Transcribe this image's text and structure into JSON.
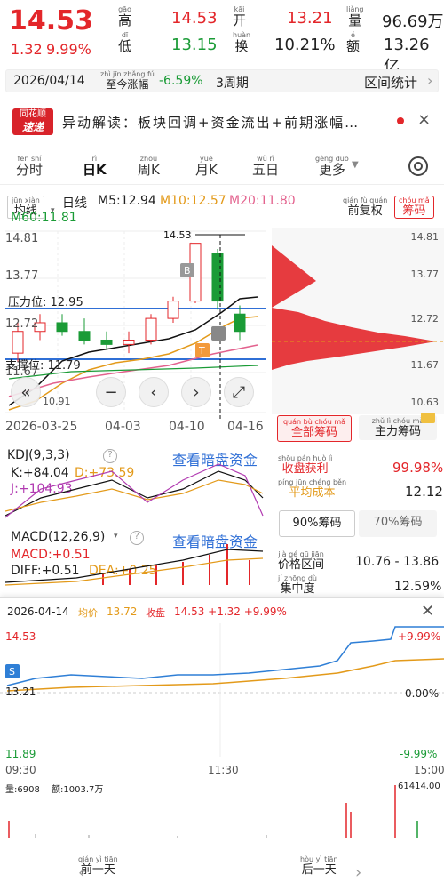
{
  "quote": {
    "price": "14.53",
    "change": "1.32",
    "change_pct": "9.99%",
    "high_label": "高",
    "high_py": "gāo",
    "high": "14.53",
    "open_label": "开",
    "open_py": "kāi",
    "open": "13.21",
    "vol_label": "量",
    "vol_py": "liàng",
    "vol": "96.69万",
    "low_label": "低",
    "low_py": "dī",
    "low": "13.15",
    "turn_label": "换",
    "turn_py": "huàn",
    "turn": "10.21%",
    "amt_label": "额",
    "amt_py": "é",
    "amt": "13.26亿"
  },
  "range": {
    "date": "2026/04/14",
    "text": "至今涨幅",
    "text_py": "zhì jīn zhǎng fú",
    "pct": "-6.59%",
    "period": "3周期",
    "stat": "区间统计"
  },
  "news": {
    "logo_top": "同花顺",
    "logo_bottom": "速递",
    "text": "异动解读：板块回调+资金流出+前期涨幅…",
    "close": "×"
  },
  "tabs": [
    {
      "py": "fēn shí",
      "hz": "分时"
    },
    {
      "py": "rì",
      "hz": "日K",
      "active": true
    },
    {
      "py": "zhōu",
      "hz": "周K"
    },
    {
      "py": "yuè",
      "hz": "月K"
    },
    {
      "py": "wǔ rì",
      "hz": "五日"
    },
    {
      "py": "gèng duō",
      "hz": "更多"
    }
  ],
  "ma": {
    "sel_py": "jūn xiàn",
    "sel": "均线",
    "title": "日线",
    "m5": "M5:12.94",
    "m10": "M10:12.57",
    "m20": "M20:11.80",
    "m60": "M60:11.81",
    "fq_py": "qián fù quán",
    "fq": "前复权",
    "cm_py": "chóu mǎ",
    "cm": "筹码"
  },
  "kchart": {
    "ylabels": [
      "14.81",
      "13.77",
      "12.72",
      "11.67",
      "10.63"
    ],
    "resist": "压力位: 12.95",
    "support": "支撑位: 11.79",
    "high_mark": "14.53",
    "low_mark": "10.91",
    "dates": [
      "2026-03-25",
      "04-03",
      "04-10",
      "04-16"
    ],
    "b": "B",
    "t": "T"
  },
  "chart_data": {
    "type": "candlestick",
    "ohlc": [
      [
        12.0,
        12.7,
        11.8,
        12.5
      ],
      [
        12.5,
        12.9,
        12.3,
        12.7
      ],
      [
        12.7,
        12.9,
        12.4,
        12.5
      ],
      [
        12.5,
        12.8,
        12.2,
        12.3
      ],
      [
        12.3,
        12.5,
        12.1,
        12.2
      ],
      [
        12.2,
        12.5,
        12.0,
        12.3
      ],
      [
        12.3,
        12.9,
        12.2,
        12.8
      ],
      [
        12.8,
        13.3,
        12.7,
        13.2
      ],
      [
        13.2,
        14.53,
        13.15,
        14.53
      ],
      [
        14.3,
        14.4,
        13.0,
        13.2
      ],
      [
        12.9,
        13.1,
        12.3,
        12.5
      ]
    ]
  },
  "kdj": {
    "label": "KDJ(9,3,3)",
    "link": "查看暗盘资金",
    "k": "K:+84.04",
    "d": "D:+73.59",
    "j": "J:+104.93"
  },
  "macd": {
    "label": "MACD(12,26,9)",
    "link": "查看暗盘资金",
    "macd": "MACD:+0.51",
    "diff": "DIFF:+0.51",
    "dea": "DEA:+0.25"
  },
  "chips": {
    "yl": [
      "14.81",
      "13.77",
      "12.72",
      "11.67",
      "10.63"
    ],
    "tab1_py": "quán bù chóu mǎ",
    "tab1": "全部筹码",
    "tab2_py": "zhǔ lì chóu mǎ",
    "tab2": "主力筹码",
    "profit_py": "shōu pán huò lì",
    "profit": "收盘获利",
    "profit_v": "99.98%",
    "cost_py": "píng jūn chéng běn",
    "cost": "平均成本",
    "cost_v": "12.12",
    "c90": "90%筹码",
    "c70": "70%筹码",
    "range_py": "jià gé qū jiān",
    "range": "价格区间",
    "range_v": "10.76 - 13.86",
    "conc_py": "jí zhōng dù",
    "conc": "集中度",
    "conc_v": "12.59%"
  },
  "intraday": {
    "date": "2026-04-14",
    "avg_lbl": "均价",
    "avg": "13.72",
    "close_lbl": "收盘",
    "close": "14.53 +1.32 +9.99%",
    "top": "14.53",
    "mid": "13.21",
    "bot": "11.89",
    "top_pct": "+9.99%",
    "mid_pct": "0.00%",
    "bot_pct": "-9.99%",
    "t1": "09:30",
    "t2": "11:30",
    "t3": "15:00",
    "vol_lbl": "量:6908",
    "amt_lbl": "额:1003.7万",
    "maxvol": "61414.00",
    "s": "S"
  },
  "nav": {
    "prev_py": "qián yì tiān",
    "prev": "前一天",
    "next_py": "hòu yì tiān",
    "next": "后一天"
  }
}
